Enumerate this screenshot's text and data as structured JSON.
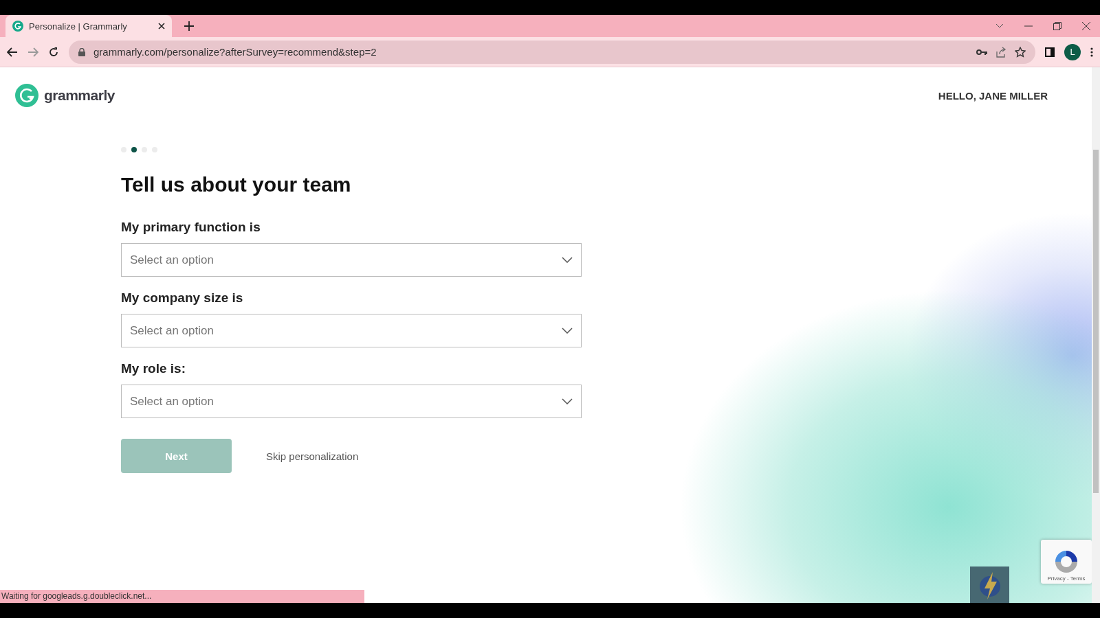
{
  "browser": {
    "tab": {
      "title": "Personalize | Grammarly",
      "selected": true
    },
    "url": "grammarly.com/personalize?afterSurvey=recommend&step=2",
    "profile_initial": "L"
  },
  "header": {
    "logo_text": "grammarly",
    "greeting": "HELLO, JANE MILLER"
  },
  "steps": [
    {
      "selected": false
    },
    {
      "selected": true
    },
    {
      "selected": false
    },
    {
      "selected": false
    }
  ],
  "title": "Tell us about your team",
  "fields": [
    {
      "label": "My primary function is",
      "placeholder": "Select an option"
    },
    {
      "label": "My company size is",
      "placeholder": "Select an option"
    },
    {
      "label": "My role is:",
      "placeholder": "Select an option"
    }
  ],
  "next_button": {
    "label": "Next",
    "disabled": true
  },
  "skip_link": "Skip personalization",
  "recaptcha": {
    "text": "Privacy - Terms"
  },
  "status_bar": "Waiting for googleads.g.doubleclick.net..."
}
